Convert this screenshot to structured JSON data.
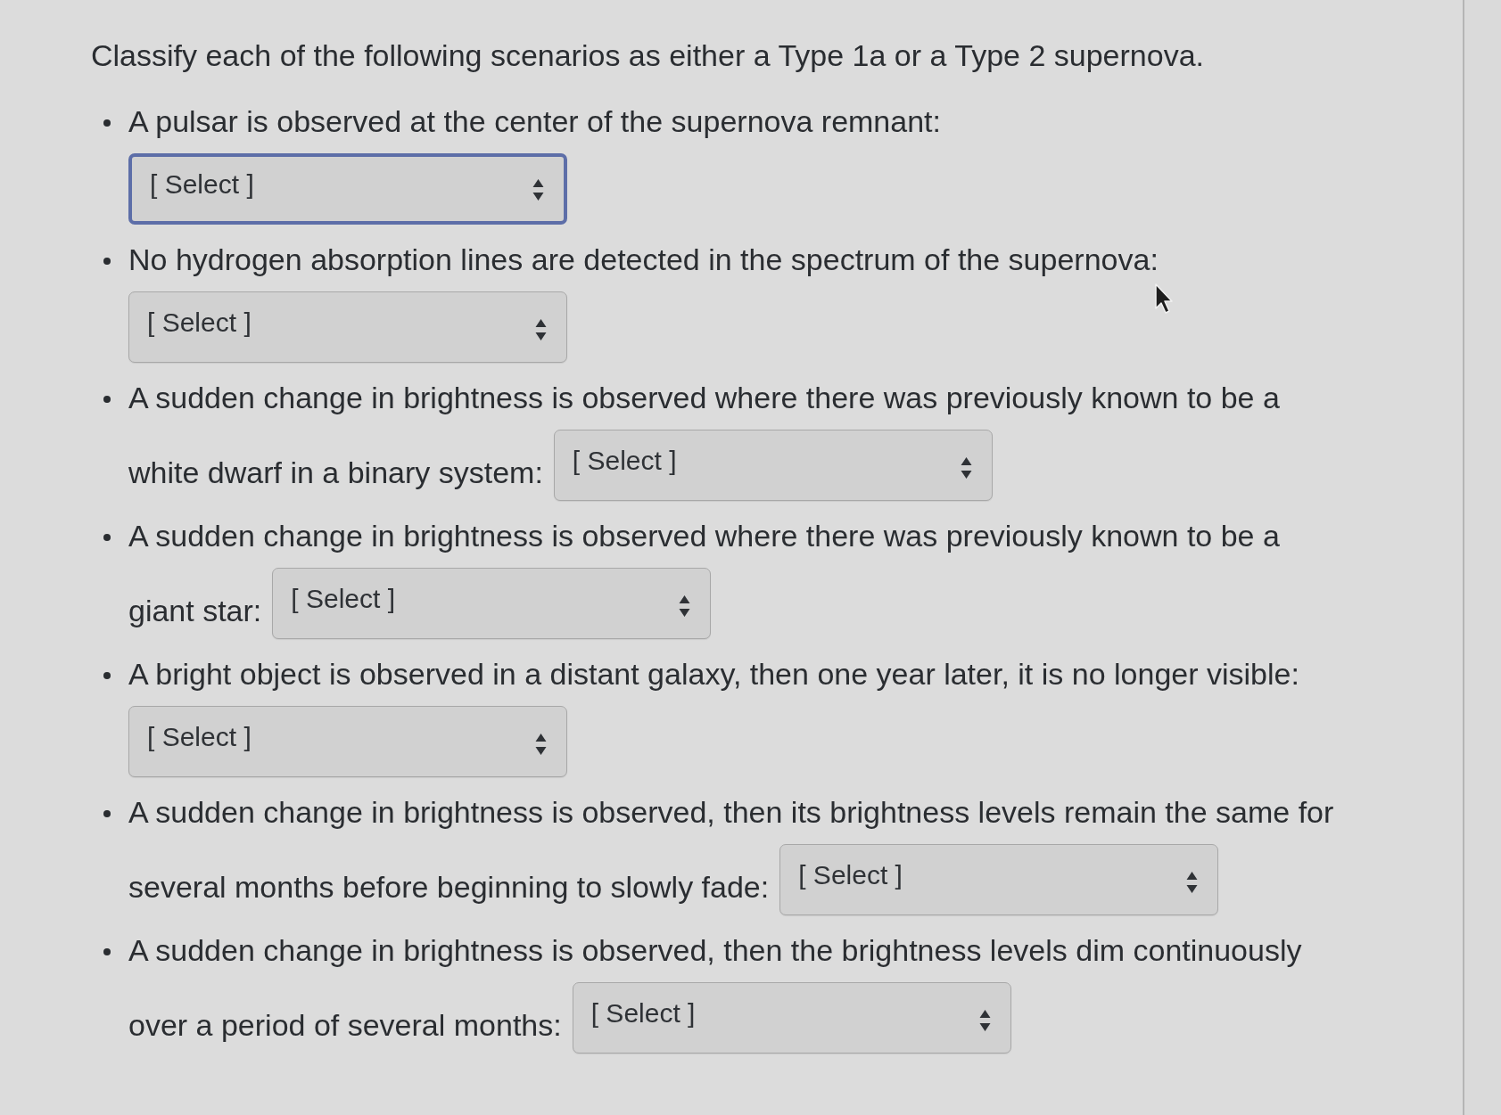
{
  "instructions": "Classify each of the following scenarios as either a Type 1a or a Type 2 supernova.",
  "questions": [
    {
      "prompt_lines": [
        "A pulsar is observed at the center of the supernova remnant:"
      ],
      "select": {
        "value": "[ Select ]",
        "focused": true
      }
    },
    {
      "prompt_lines": [
        "No hydrogen absorption lines are detected in the spectrum of the supernova:"
      ],
      "select": {
        "value": "[ Select ]",
        "focused": false
      }
    },
    {
      "prompt_lines": [
        "A sudden change in brightness is observed where there was previously known to be a",
        "white dwarf in a binary system:"
      ],
      "select": {
        "value": "[ Select ]",
        "focused": false
      }
    },
    {
      "prompt_lines": [
        "A sudden change in brightness is observed where there was previously known to be a",
        "giant star:"
      ],
      "select": {
        "value": "[ Select ]",
        "focused": false
      }
    },
    {
      "prompt_lines": [
        "A bright object is observed in a distant galaxy, then one year later, it is no longer visible:"
      ],
      "select": {
        "value": "[ Select ]",
        "focused": false
      }
    },
    {
      "prompt_lines": [
        "A sudden change in brightness is observed, then its brightness levels remain the same for",
        "several months before beginning to slowly fade:"
      ],
      "select": {
        "value": "[ Select ]",
        "focused": false
      }
    },
    {
      "prompt_lines": [
        "A sudden change in brightness is observed, then the brightness levels dim continuously",
        "over a period of several months:"
      ],
      "select": {
        "value": "[ Select ]",
        "focused": false
      }
    }
  ]
}
